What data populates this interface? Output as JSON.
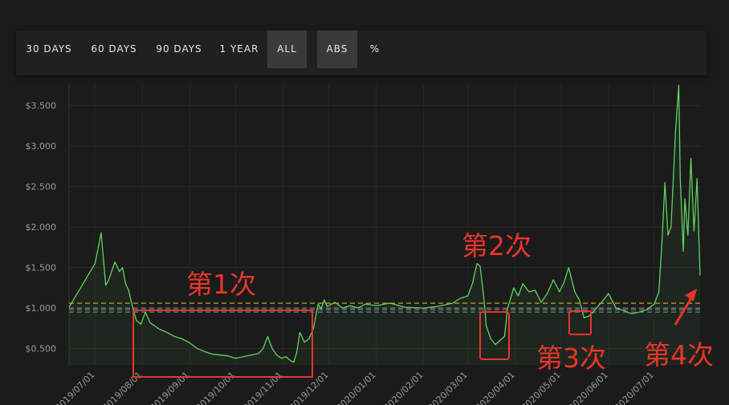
{
  "toolbar": {
    "range_buttons": [
      "30 DAYS",
      "60 DAYS",
      "90 DAYS",
      "1 YEAR",
      "ALL"
    ],
    "mode_buttons": [
      "ABS",
      "%"
    ],
    "active_range": "ALL",
    "active_mode": "ABS"
  },
  "colors": {
    "background": "#1b1b1b",
    "line": "#5fd35f",
    "annotation": "#e8352a",
    "ref_yellow": "#b59a2a",
    "ref_gray": "#7a7a7a",
    "ref_blue": "#5a7ea0"
  },
  "chart_data": {
    "type": "line",
    "ylim": [
      0.3,
      3.75
    ],
    "y_ticks": [
      0.5,
      1.0,
      1.5,
      2.0,
      2.5,
      3.0,
      3.5
    ],
    "y_tick_labels": [
      "$0.500",
      "$1.000",
      "$1.500",
      "$2.000",
      "$2.500",
      "$3.000",
      "$3.500"
    ],
    "x_tick_labels": [
      "2019/07/01",
      "2019/08/01",
      "2019/09/01",
      "2019/10/01",
      "2019/11/01",
      "2019/12/01",
      "2020/01/01",
      "2020/02/01",
      "2020/03/01",
      "2020/04/01",
      "2020/05/01",
      "2020/06/01",
      "2020/07/01"
    ],
    "grid": true,
    "reference_lines": [
      1.06,
      1.0,
      0.98,
      0.95
    ],
    "series": [
      {
        "x": [
          "2019/06/14",
          "2019/07/01",
          "2019/07/05",
          "2019/07/08",
          "2019/07/10",
          "2019/07/14",
          "2019/07/17",
          "2019/07/19",
          "2019/07/21",
          "2019/07/23",
          "2019/07/25",
          "2019/07/28",
          "2019/07/31",
          "2019/08/03",
          "2019/08/06",
          "2019/08/09",
          "2019/08/12",
          "2019/08/17",
          "2019/08/22",
          "2019/08/27",
          "2019/09/01",
          "2019/09/06",
          "2019/09/11",
          "2019/09/16",
          "2019/09/21",
          "2019/09/26",
          "2019/10/01",
          "2019/10/06",
          "2019/10/11",
          "2019/10/16",
          "2019/10/19",
          "2019/10/22",
          "2019/10/25",
          "2019/10/28",
          "2019/10/31",
          "2019/11/03",
          "2019/11/06",
          "2019/11/08",
          "2019/11/10",
          "2019/11/12",
          "2019/11/15",
          "2019/11/18",
          "2019/11/21",
          "2019/11/24",
          "2019/11/26",
          "2019/11/28",
          "2019/11/30",
          "2019/12/02",
          "2019/12/05",
          "2019/12/10",
          "2019/12/15",
          "2019/12/20",
          "2019/12/25",
          "2020/01/01",
          "2020/01/10",
          "2020/01/20",
          "2020/02/01",
          "2020/02/10",
          "2020/02/20",
          "2020/02/25",
          "2020/03/01",
          "2020/03/04",
          "2020/03/07",
          "2020/03/09",
          "2020/03/11",
          "2020/03/12",
          "2020/03/13",
          "2020/03/16",
          "2020/03/19",
          "2020/03/22",
          "2020/03/25",
          "2020/03/27",
          "2020/03/29",
          "2020/03/31",
          "2020/04/03",
          "2020/04/06",
          "2020/04/10",
          "2020/04/14",
          "2020/04/18",
          "2020/04/22",
          "2020/04/26",
          "2020/04/30",
          "2020/05/03",
          "2020/05/06",
          "2020/05/10",
          "2020/05/13",
          "2020/05/16",
          "2020/05/19",
          "2020/05/22",
          "2020/05/25",
          "2020/05/28",
          "2020/06/01",
          "2020/06/06",
          "2020/06/11",
          "2020/06/16",
          "2020/06/21",
          "2020/06/26",
          "2020/07/01",
          "2020/07/04",
          "2020/07/06",
          "2020/07/08",
          "2020/07/10",
          "2020/07/12",
          "2020/07/14",
          "2020/07/15",
          "2020/07/17",
          "2020/07/18",
          "2020/07/20",
          "2020/07/21",
          "2020/07/23",
          "2020/07/25",
          "2020/07/27",
          "2020/07/29",
          "2020/07/31"
        ],
        "values": [
          1.01,
          1.55,
          1.93,
          1.28,
          1.35,
          1.57,
          1.45,
          1.5,
          1.3,
          1.22,
          1.06,
          0.85,
          0.8,
          0.95,
          0.82,
          0.78,
          0.74,
          0.7,
          0.65,
          0.62,
          0.57,
          0.5,
          0.46,
          0.43,
          0.42,
          0.41,
          0.38,
          0.4,
          0.42,
          0.44,
          0.5,
          0.65,
          0.5,
          0.42,
          0.38,
          0.4,
          0.35,
          0.33,
          0.45,
          0.7,
          0.58,
          0.62,
          0.75,
          1.05,
          0.99,
          1.1,
          1.02,
          1.04,
          1.07,
          1.0,
          1.03,
          1.0,
          1.05,
          1.03,
          1.06,
          1.01,
          1.0,
          1.02,
          1.06,
          1.12,
          1.15,
          1.3,
          1.55,
          1.52,
          1.2,
          1.02,
          0.78,
          0.62,
          0.55,
          0.6,
          0.65,
          1.0,
          1.12,
          1.25,
          1.15,
          1.3,
          1.2,
          1.22,
          1.07,
          1.18,
          1.35,
          1.2,
          1.32,
          1.5,
          1.2,
          1.1,
          0.88,
          0.9,
          0.95,
          1.02,
          1.08,
          1.18,
          1.0,
          0.97,
          0.93,
          0.95,
          0.98,
          1.05,
          1.2,
          1.8,
          2.55,
          1.9,
          2.0,
          2.8,
          3.2,
          3.75,
          2.6,
          1.7,
          2.35,
          1.9,
          2.85,
          1.95,
          2.6,
          1.4
        ]
      }
    ],
    "annotations": [
      "第1次",
      "第2次",
      "第3次",
      "第4次"
    ]
  }
}
